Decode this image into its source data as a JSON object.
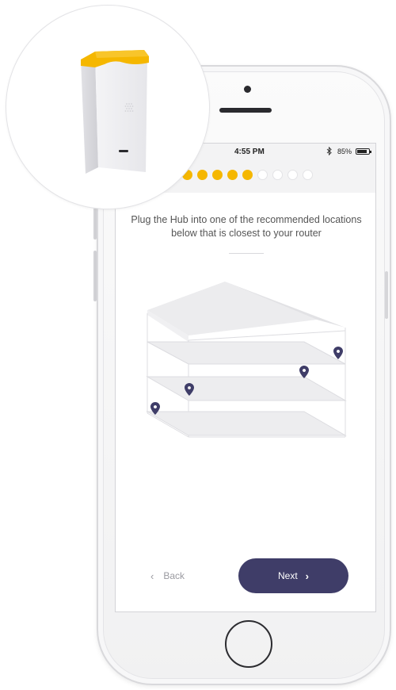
{
  "status_bar": {
    "time": "4:55 PM",
    "battery_text": "85%",
    "battery_level": 0.85,
    "bluetooth_icon": "bluetooth-icon"
  },
  "progress": {
    "total_steps": 9,
    "completed_steps": 5
  },
  "instruction": "Plug the Hub into one of the recommended locations below that is closest to your router",
  "house_diagram": {
    "location_pins": 4
  },
  "nav": {
    "back_label": "Back",
    "next_label": "Next"
  },
  "icons": {
    "back": "chevron-left-icon",
    "next": "chevron-right-icon",
    "pin": "location-pin-icon"
  },
  "colors": {
    "accent_yellow": "#f5b700",
    "primary_button": "#3f3d68",
    "pin": "#3f3d68"
  }
}
